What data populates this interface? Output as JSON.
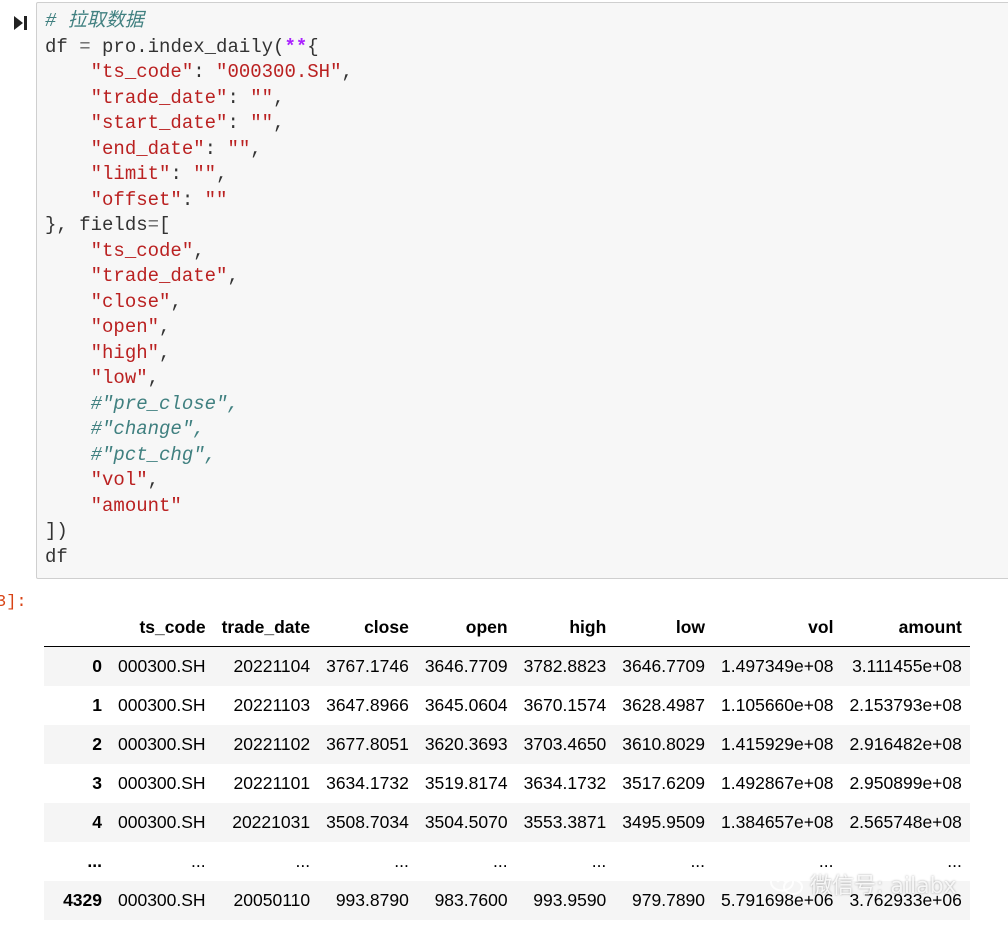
{
  "cell": {
    "comment": "# 拉取数据",
    "code_lines": [
      "df = pro.index_daily(**{",
      "    \"ts_code\": \"000300.SH\",",
      "    \"trade_date\": \"\",",
      "    \"start_date\": \"\",",
      "    \"end_date\": \"\",",
      "    \"limit\": \"\",",
      "    \"offset\": \"\"",
      "}, fields=[",
      "    \"ts_code\",",
      "    \"trade_date\",",
      "    \"close\",",
      "    \"open\",",
      "    \"high\",",
      "    \"low\",",
      "    #\"pre_close\",",
      "    #\"change\",",
      "    #\"pct_chg\",",
      "    \"vol\",",
      "    \"amount\"",
      "])",
      "df"
    ]
  },
  "output_prompt": "3]:",
  "table": {
    "columns": [
      "ts_code",
      "trade_date",
      "close",
      "open",
      "high",
      "low",
      "vol",
      "amount"
    ],
    "rows": [
      {
        "index": "0",
        "cells": [
          "000300.SH",
          "20221104",
          "3767.1746",
          "3646.7709",
          "3782.8823",
          "3646.7709",
          "1.497349e+08",
          "3.111455e+08"
        ]
      },
      {
        "index": "1",
        "cells": [
          "000300.SH",
          "20221103",
          "3647.8966",
          "3645.0604",
          "3670.1574",
          "3628.4987",
          "1.105660e+08",
          "2.153793e+08"
        ]
      },
      {
        "index": "2",
        "cells": [
          "000300.SH",
          "20221102",
          "3677.8051",
          "3620.3693",
          "3703.4650",
          "3610.8029",
          "1.415929e+08",
          "2.916482e+08"
        ]
      },
      {
        "index": "3",
        "cells": [
          "000300.SH",
          "20221101",
          "3634.1732",
          "3519.8174",
          "3634.1732",
          "3517.6209",
          "1.492867e+08",
          "2.950899e+08"
        ]
      },
      {
        "index": "4",
        "cells": [
          "000300.SH",
          "20221031",
          "3508.7034",
          "3504.5070",
          "3553.3871",
          "3495.9509",
          "1.384657e+08",
          "2.565748e+08"
        ]
      },
      {
        "index": "...",
        "cells": [
          "...",
          "...",
          "...",
          "...",
          "...",
          "...",
          "...",
          "..."
        ]
      },
      {
        "index": "4329",
        "cells": [
          "000300.SH",
          "20050110",
          "993.8790",
          "983.7600",
          "993.9590",
          "979.7890",
          "5.791698e+06",
          "3.762933e+06"
        ]
      }
    ]
  },
  "watermark": "微信号: ailabx",
  "icons": {
    "run": "run-cell-icon",
    "wechat": "wechat-icon"
  }
}
